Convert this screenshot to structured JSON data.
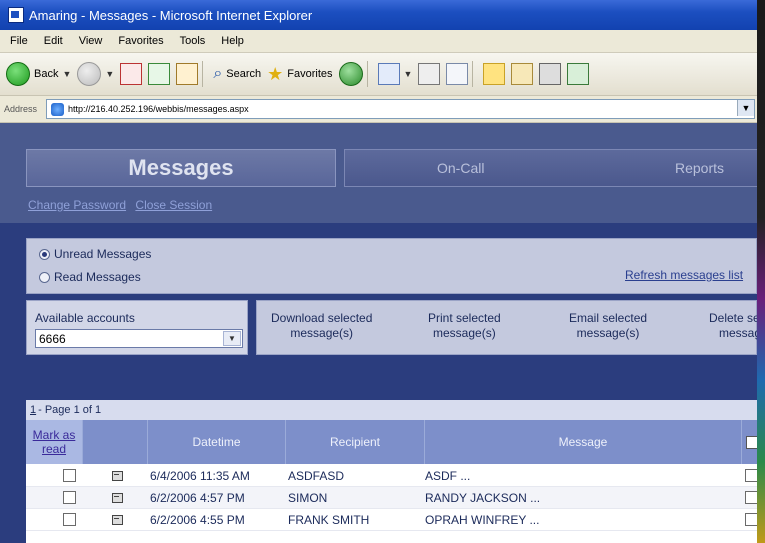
{
  "window": {
    "title": "Amaring - Messages - Microsoft Internet Explorer",
    "menu": [
      "File",
      "Edit",
      "View",
      "Favorites",
      "Tools",
      "Help"
    ],
    "toolbar": {
      "back": "Back",
      "search": "Search",
      "favorites": "Favorites"
    },
    "address": {
      "label": "Address",
      "url": "http://216.40.252.196/webbis/messages.aspx"
    }
  },
  "app": {
    "tabs": [
      "Messages",
      "On-Call",
      "Reports"
    ],
    "links": [
      "Change Password",
      "Close Session"
    ],
    "filters": {
      "unread": "Unread Messages",
      "read": "Read Messages",
      "selected": "unread"
    },
    "refresh": "Refresh messages list",
    "accounts": {
      "label": "Available accounts",
      "value": "6666"
    },
    "actions": [
      {
        "line1": "Download selected",
        "line2": "message(s)"
      },
      {
        "line1": "Print selected",
        "line2": "message(s)"
      },
      {
        "line1": "Email selected",
        "line2": "message(s)"
      },
      {
        "line1": "Delete selected",
        "line2": "message(s)"
      }
    ]
  },
  "grid": {
    "pager": {
      "page_link": "1",
      "text": "- Page 1 of 1"
    },
    "headers": {
      "mark": "Mark as read",
      "datetime": "Datetime",
      "recipient": "Recipient",
      "message": "Message"
    },
    "rows": [
      {
        "datetime": "6/4/2006 11:35 AM",
        "recipient": "ASDFASD",
        "message": "ASDF ..."
      },
      {
        "datetime": "6/2/2006 4:57 PM",
        "recipient": "SIMON",
        "message": "RANDY JACKSON ..."
      },
      {
        "datetime": "6/2/2006 4:55 PM",
        "recipient": "FRANK SMITH",
        "message": "OPRAH WINFREY ..."
      }
    ]
  }
}
